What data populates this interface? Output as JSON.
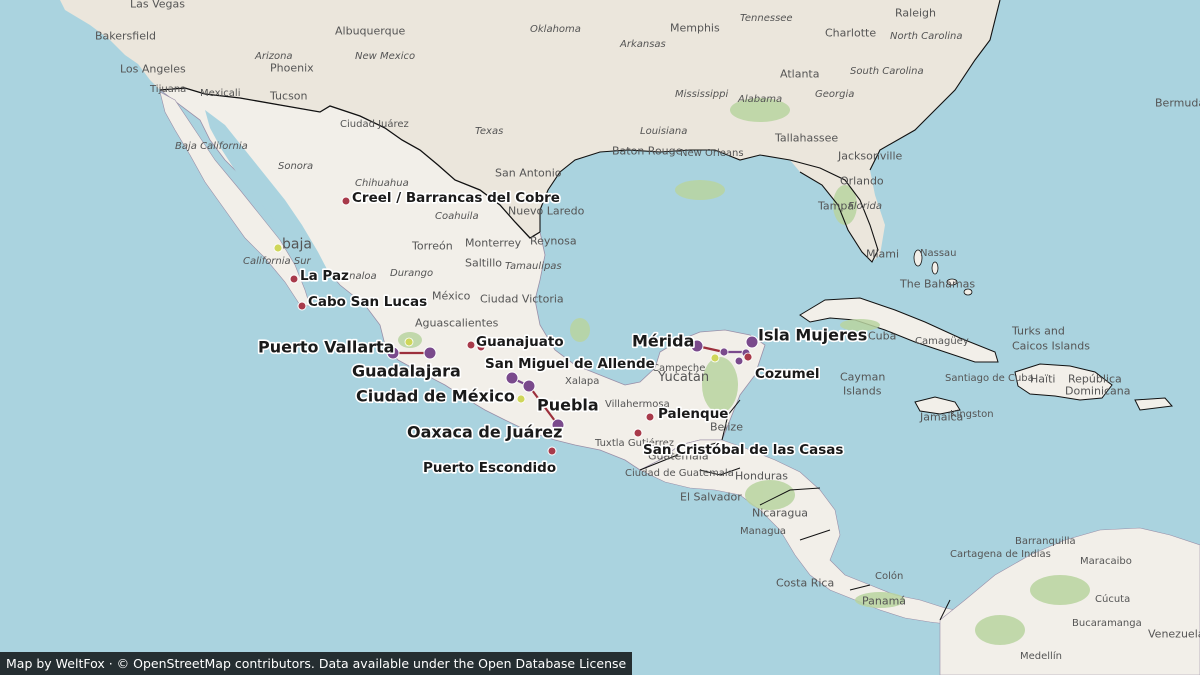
{
  "attribution": "Map by WeltFox · © OpenStreetMap contributors. Data available under the Open Database License",
  "colors": {
    "water": "#aad3df",
    "land": "#f2efe9",
    "usa_land": "#ebe6dc",
    "forest": "#b9d4a0",
    "marker_red": "#a83a4a",
    "marker_purple": "#7a4a8c",
    "marker_yellow": "#cfd65a",
    "route_red": "#9c2f3c",
    "route_purple": "#7a4a8c"
  },
  "markers": [
    {
      "name": "Creel / Barrancas del Cobre",
      "kind": "red",
      "size": "small"
    },
    {
      "name": "La Paz",
      "kind": "red",
      "size": "small"
    },
    {
      "name": "Cabo San Lucas",
      "kind": "red",
      "size": "small"
    },
    {
      "name": "Puerto Vallarta",
      "kind": "purple",
      "size": "large"
    },
    {
      "name": "Guadalajara",
      "kind": "purple",
      "size": "large"
    },
    {
      "name": "Guanajuato",
      "kind": "red",
      "size": "small"
    },
    {
      "name": "San Miguel de Allende",
      "kind": "red",
      "size": "small"
    },
    {
      "name": "Ciudad de México",
      "kind": "purple",
      "size": "large"
    },
    {
      "name": "Puebla",
      "kind": "purple",
      "size": "large"
    },
    {
      "name": "Oaxaca de Juárez",
      "kind": "purple",
      "size": "large"
    },
    {
      "name": "Puerto Escondido",
      "kind": "red",
      "size": "small"
    },
    {
      "name": "Palenque",
      "kind": "red",
      "size": "small"
    },
    {
      "name": "San Cristóbal de las Casas",
      "kind": "red",
      "size": "small"
    },
    {
      "name": "Mérida",
      "kind": "purple",
      "size": "large"
    },
    {
      "name": "Isla Mujeres",
      "kind": "purple",
      "size": "large"
    },
    {
      "name": "Cozumel",
      "kind": "purple",
      "size": "small"
    }
  ],
  "basemap_labels": {
    "las_vegas": "Las Vegas",
    "bakersfield": "Bakersfield",
    "los_angeles": "Los Angeles",
    "tijuana": "Tijuana",
    "mexicali": "Mexicali",
    "phoenix": "Phoenix",
    "arizona": "Arizona",
    "tucson": "Tucson",
    "albuquerque": "Albuquerque",
    "new_mexico": "New Mexico",
    "ciudad_juarez": "Ciudad Juárez",
    "oklahoma": "Oklahoma",
    "memphis": "Memphis",
    "tennessee": "Tennessee",
    "raleigh": "Raleigh",
    "north_carolina": "North Carolina",
    "charlotte": "Charlotte",
    "atlanta": "Atlanta",
    "south_carolina": "South Carolina",
    "arkansas": "Arkansas",
    "mississippi": "Mississippi",
    "alabama": "Alabama",
    "georgia": "Georgia",
    "louisiana": "Louisiana",
    "tallahassee": "Tallahassee",
    "jacksonville": "Jacksonville",
    "baton_rouge": "Baton Rouge",
    "new_orleans": "New Orleans",
    "texas": "Texas",
    "san_antonio": "San Antonio",
    "orlando": "Orlando",
    "florida": "Florida",
    "tampa": "Tampa",
    "miami": "Miami",
    "bermuda": "Bermuda",
    "baja_california": "Baja California",
    "sonora": "Sonora",
    "chihuahua": "Chihuahua",
    "coahuila": "Coahuila",
    "nuevo_laredo": "Nuevo Laredo",
    "reynosa": "Reynosa",
    "monterrey": "Monterrey",
    "torreon": "Torreón",
    "saltillo": "Saltillo",
    "durango": "Durango",
    "tamaulipas": "Tamaulipas",
    "ciudad_victoria": "Ciudad Victoria",
    "mexico_country": "México",
    "aguascalientes": "Aguascalientes",
    "baja": "baja",
    "baja_california_sur": "California Sur",
    "sinaloa": "Sinaloa",
    "nassau": "Nassau",
    "the_bahamas": "The Bahamas",
    "cuba": "Cuba",
    "camaguey": "Camagüey",
    "turks": "Turks and",
    "caicos": "Caicos Islands",
    "santiago_de_cuba": "Santiago de Cuba",
    "haiti": "Haïti",
    "republica": "República",
    "dominicana": "Dominicana",
    "cayman": "Cayman",
    "islands": "Islands",
    "jamaica": "Jamaica",
    "kingston": "Kingston",
    "campeche": "Campeche",
    "yucatan": "Yucatán",
    "villahermosa": "Villahermosa",
    "tuxtla": "Tuxtla Gutiérrez",
    "veracruz": "Xalapa",
    "belize": "Belize",
    "guatemala": "Guatemala",
    "ciudad_guatemala": "Ciudad de Guatemala",
    "honduras": "Honduras",
    "el_salvador": "El Salvador",
    "managua": "Managua",
    "nicaragua": "Nicaragua",
    "costa_rica": "Costa Rica",
    "panama": "Panamá",
    "colon": "Colón",
    "cartagena": "Cartagena de Indias",
    "barranquilla": "Barranquilla",
    "maracaibo": "Maracaibo",
    "bucaramanga": "Bucaramanga",
    "medellin": "Medellín",
    "venezuela": "Venezuela",
    "cucuta": "Cúcuta"
  }
}
